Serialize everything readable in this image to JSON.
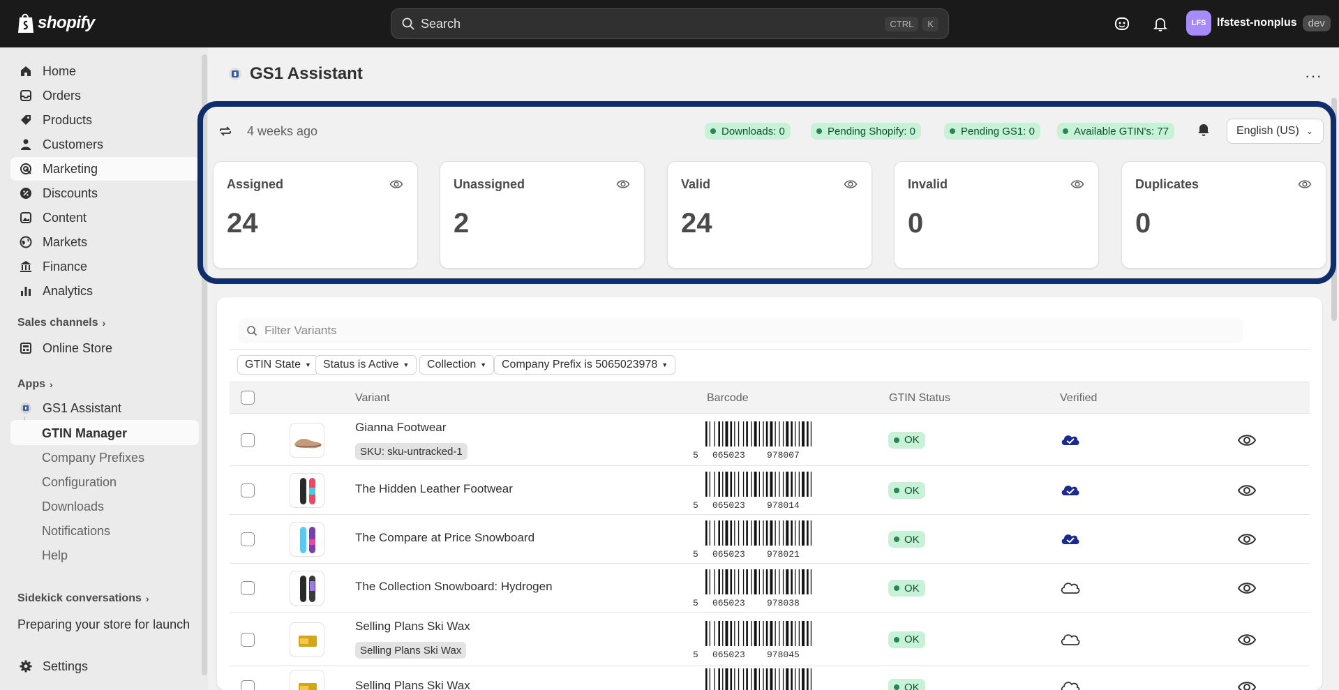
{
  "topbar": {
    "brand": "shopify",
    "search_placeholder": "Search",
    "shortcut_ctrl": "CTRL",
    "shortcut_key": "K",
    "user_initials": "LFS",
    "user_name": "lfstest-nonplus",
    "env_badge": "dev"
  },
  "sidebar": {
    "items": [
      {
        "label": "Home",
        "icon": "home-icon"
      },
      {
        "label": "Orders",
        "icon": "orders-icon"
      },
      {
        "label": "Products",
        "icon": "tag-icon"
      },
      {
        "label": "Customers",
        "icon": "person-icon"
      },
      {
        "label": "Marketing",
        "icon": "target-icon"
      },
      {
        "label": "Discounts",
        "icon": "discount-icon"
      },
      {
        "label": "Content",
        "icon": "image-icon"
      },
      {
        "label": "Markets",
        "icon": "globe-icon"
      },
      {
        "label": "Finance",
        "icon": "bank-icon"
      },
      {
        "label": "Analytics",
        "icon": "bar-chart-icon"
      }
    ],
    "sales_channels_label": "Sales channels",
    "online_store_label": "Online Store",
    "apps_label": "Apps",
    "app_name": "GS1 Assistant",
    "app_subitems": [
      "GTIN Manager",
      "Company Prefixes",
      "Configuration",
      "Downloads",
      "Notifications",
      "Help"
    ],
    "sidekick_label": "Sidekick conversations",
    "sidekick_item": "Preparing your store for launch",
    "settings_label": "Settings"
  },
  "page": {
    "title": "GS1 Assistant",
    "last_sync": "4 weeks ago",
    "pills": [
      "Downloads: 0",
      "Pending Shopify: 0",
      "Pending GS1: 0",
      "Available GTIN's: 77"
    ],
    "language": "English (US)"
  },
  "stats": [
    {
      "label": "Assigned",
      "value": "24"
    },
    {
      "label": "Unassigned",
      "value": "2"
    },
    {
      "label": "Valid",
      "value": "24"
    },
    {
      "label": "Invalid",
      "value": "0"
    },
    {
      "label": "Duplicates",
      "value": "0"
    }
  ],
  "table": {
    "filter_placeholder": "Filter Variants",
    "chips": [
      "GTIN State",
      "Status is Active",
      "Collection",
      "Company Prefix is 5065023978"
    ],
    "headers": {
      "variant": "Variant",
      "barcode": "Barcode",
      "gtin_status": "GTIN Status",
      "verified": "Verified"
    },
    "rows": [
      {
        "name": "Gianna Footwear",
        "tag": "SKU: sku-untracked-1",
        "barcode_lead": "5",
        "barcode_left": "065023",
        "barcode_right": "978007",
        "status": "OK",
        "verified": true,
        "thumb": "shoe"
      },
      {
        "name": "The Hidden Leather Footwear",
        "tag": "",
        "barcode_lead": "5",
        "barcode_left": "065023",
        "barcode_right": "978014",
        "status": "OK",
        "verified": true,
        "thumb": "snowboard-a"
      },
      {
        "name": "The Compare at Price Snowboard",
        "tag": "",
        "barcode_lead": "5",
        "barcode_left": "065023",
        "barcode_right": "978021",
        "status": "OK",
        "verified": true,
        "thumb": "snowboard-b"
      },
      {
        "name": "The Collection Snowboard: Hydrogen",
        "tag": "",
        "barcode_lead": "5",
        "barcode_left": "065023",
        "barcode_right": "978038",
        "status": "OK",
        "verified": false,
        "thumb": "snowboard-c"
      },
      {
        "name": "Selling Plans Ski Wax",
        "tag": "Selling Plans Ski Wax",
        "barcode_lead": "5",
        "barcode_left": "065023",
        "barcode_right": "978045",
        "status": "OK",
        "verified": false,
        "thumb": "wax"
      },
      {
        "name": "Selling Plans Ski Wax",
        "tag": "",
        "barcode_lead": "",
        "barcode_left": "",
        "barcode_right": "",
        "status": "OK",
        "verified": false,
        "thumb": "wax"
      }
    ]
  },
  "colors": {
    "topbar_bg": "#1a1a1a",
    "highlight_border": "#0f2d6b",
    "success_bg": "#c7f2d7",
    "success_dot": "#29845a",
    "verified_cloud": "#1b2a8f"
  }
}
